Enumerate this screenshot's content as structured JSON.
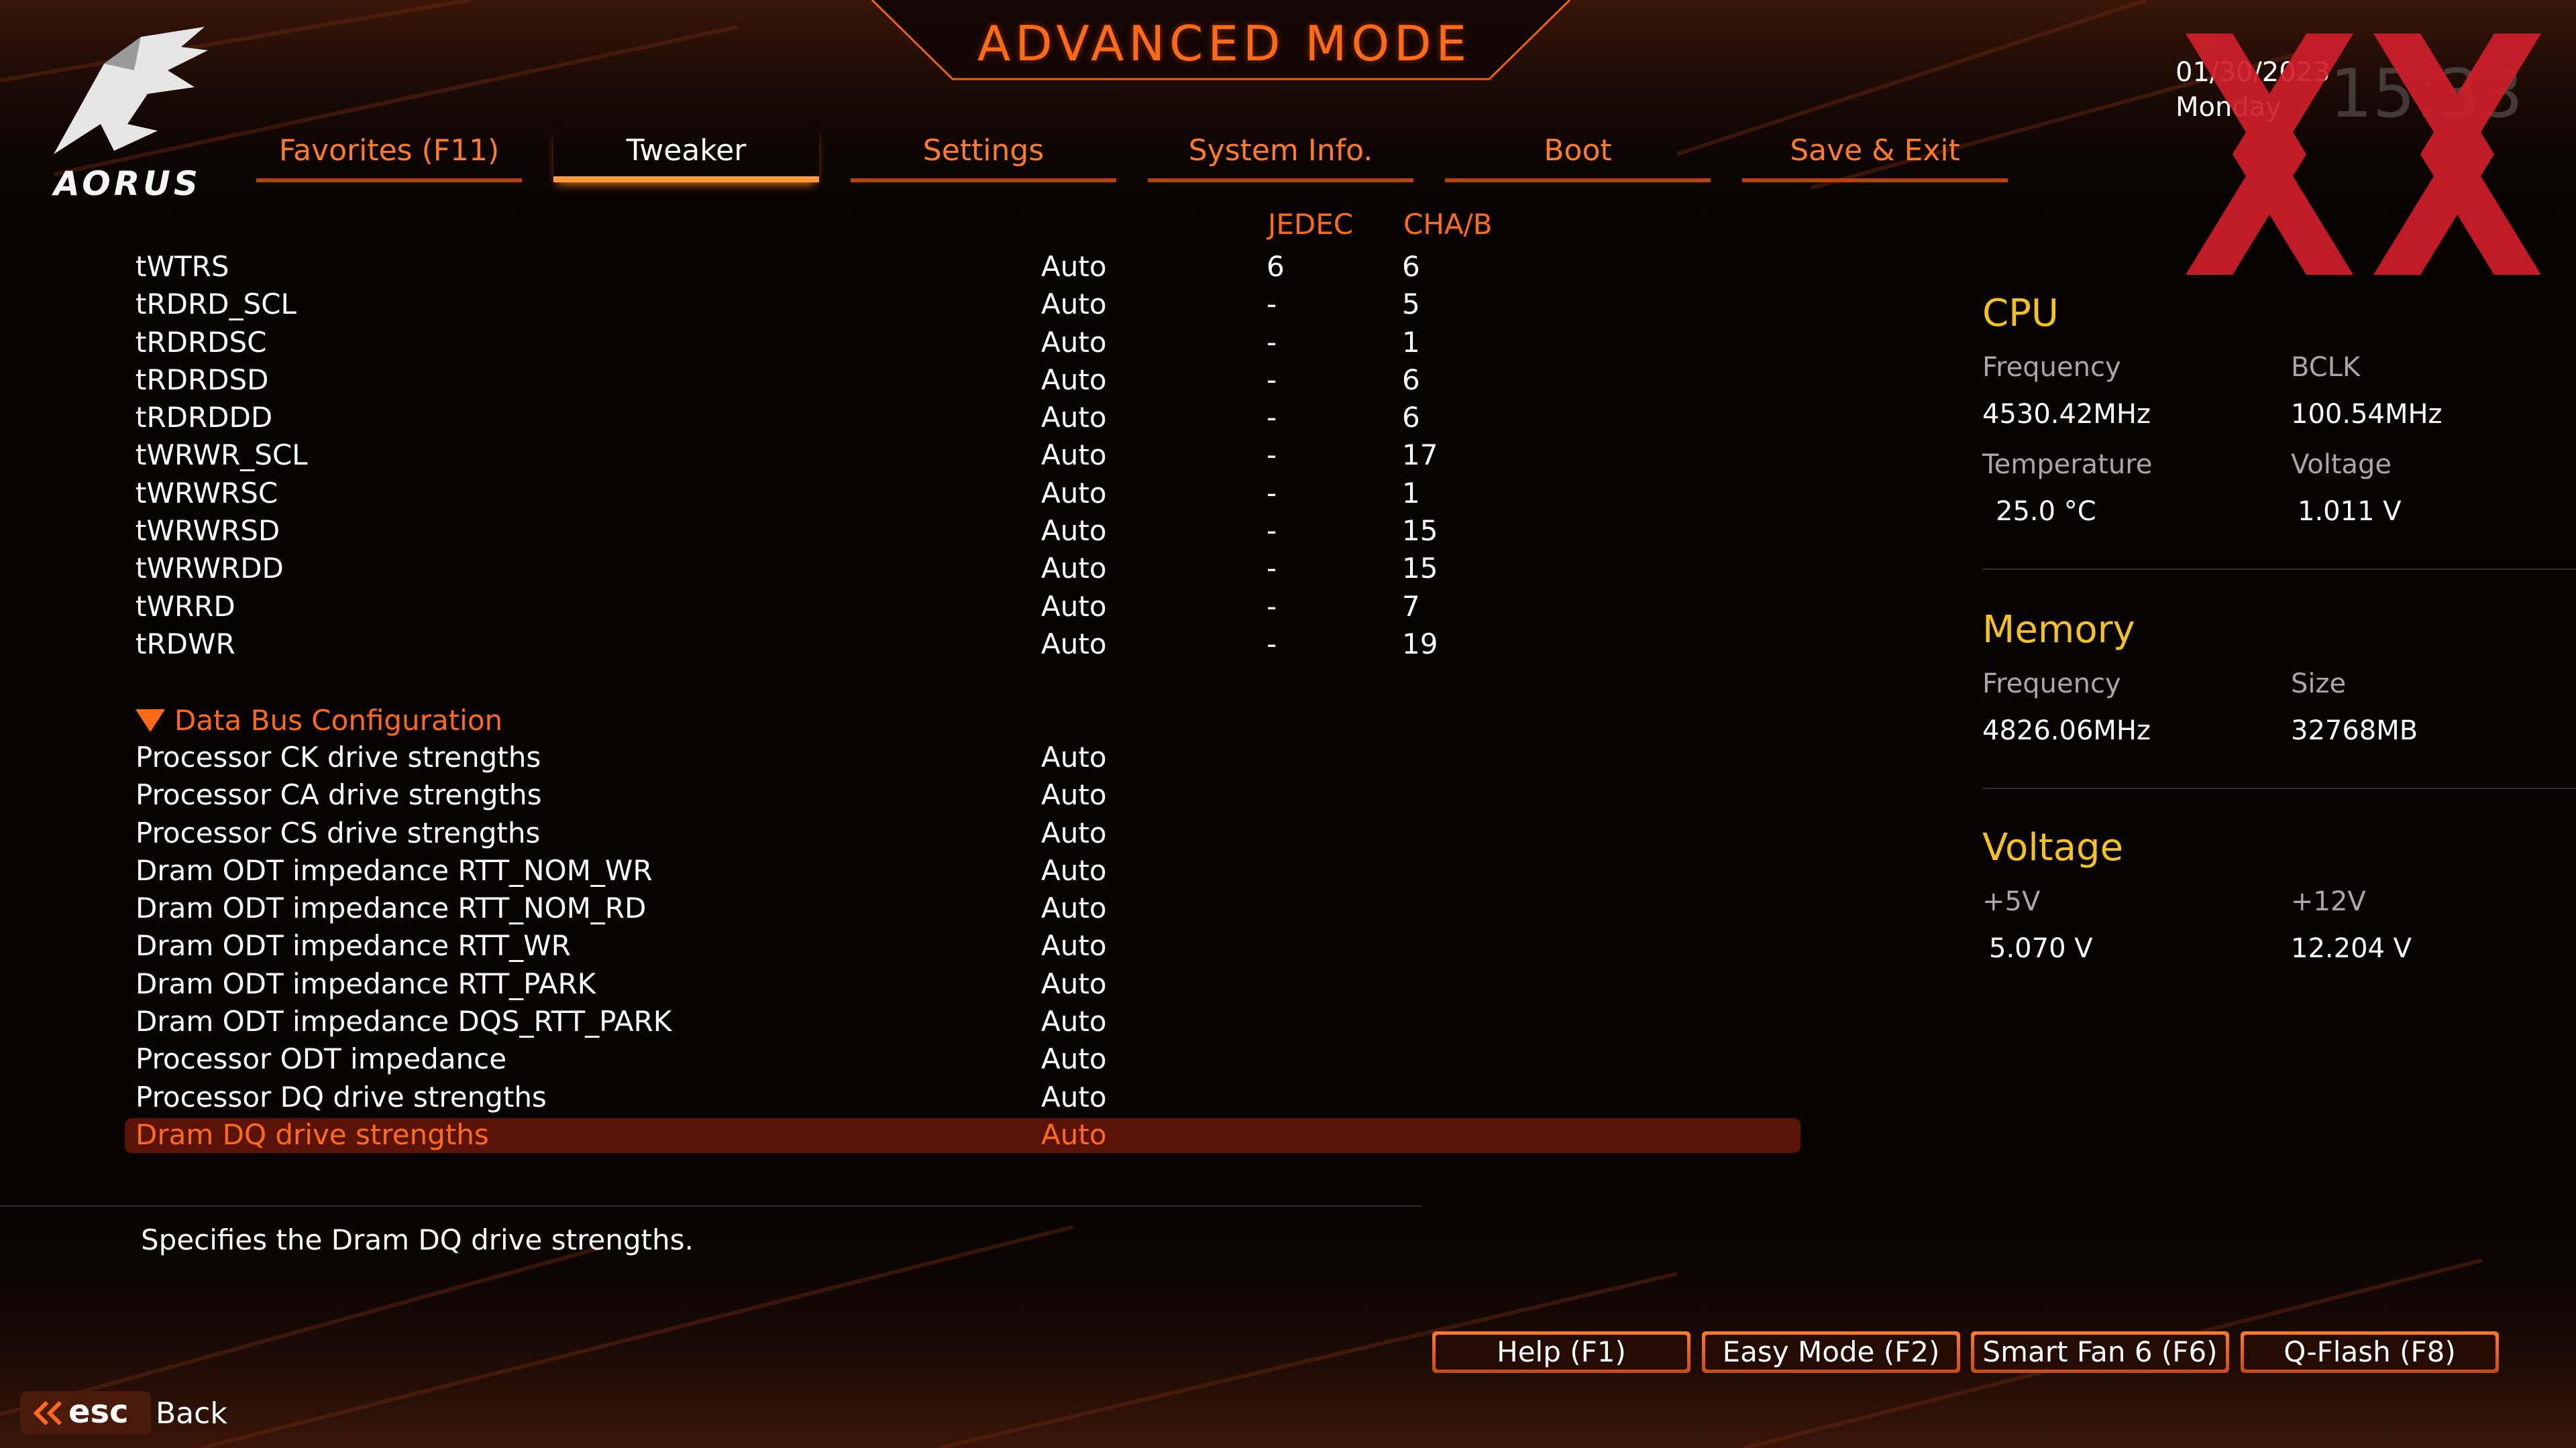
{
  "header": {
    "title": "ADVANCED MODE",
    "brand": "AORUS",
    "date": "01/30/2023",
    "day": "Monday",
    "time": "15:33"
  },
  "tabs": [
    {
      "label": "Favorites (F11)",
      "active": false
    },
    {
      "label": "Tweaker",
      "active": true
    },
    {
      "label": "Settings",
      "active": false
    },
    {
      "label": "System Info.",
      "active": false
    },
    {
      "label": "Boot",
      "active": false
    },
    {
      "label": "Save & Exit",
      "active": false
    }
  ],
  "columns": {
    "jedec": "JEDEC",
    "cha_b": "CHA/B"
  },
  "timings": [
    {
      "name": "tWTRS",
      "value": "Auto",
      "jedec": "6",
      "cha_b": "6"
    },
    {
      "name": "tRDRD_SCL",
      "value": "Auto",
      "jedec": "-",
      "cha_b": "5"
    },
    {
      "name": "tRDRDSC",
      "value": "Auto",
      "jedec": "-",
      "cha_b": "1"
    },
    {
      "name": "tRDRDSD",
      "value": "Auto",
      "jedec": "-",
      "cha_b": "6"
    },
    {
      "name": "tRDRDDD",
      "value": "Auto",
      "jedec": "-",
      "cha_b": "6"
    },
    {
      "name": "tWRWR_SCL",
      "value": "Auto",
      "jedec": "-",
      "cha_b": "17"
    },
    {
      "name": "tWRWRSC",
      "value": "Auto",
      "jedec": "-",
      "cha_b": "1"
    },
    {
      "name": "tWRWRSD",
      "value": "Auto",
      "jedec": "-",
      "cha_b": "15"
    },
    {
      "name": "tWRWRDD",
      "value": "Auto",
      "jedec": "-",
      "cha_b": "15"
    },
    {
      "name": "tWRRD",
      "value": "Auto",
      "jedec": "-",
      "cha_b": "7"
    },
    {
      "name": "tRDWR",
      "value": "Auto",
      "jedec": "-",
      "cha_b": "19"
    }
  ],
  "section": {
    "label": "Data Bus Configuration"
  },
  "bus_items": [
    {
      "name": "Processor CK drive strengths",
      "value": "Auto"
    },
    {
      "name": "Processor CA drive strengths",
      "value": "Auto"
    },
    {
      "name": "Processor CS drive strengths",
      "value": "Auto"
    },
    {
      "name": "Dram ODT impedance RTT_NOM_WR",
      "value": "Auto"
    },
    {
      "name": "Dram ODT impedance RTT_NOM_RD",
      "value": "Auto"
    },
    {
      "name": "Dram ODT impedance RTT_WR",
      "value": "Auto"
    },
    {
      "name": "Dram ODT impedance RTT_PARK",
      "value": "Auto"
    },
    {
      "name": "Dram ODT impedance DQS_RTT_PARK",
      "value": "Auto"
    },
    {
      "name": "Processor ODT impedance",
      "value": "Auto"
    },
    {
      "name": "Processor DQ drive strengths",
      "value": "Auto"
    },
    {
      "name": "Dram DQ drive strengths",
      "value": "Auto",
      "selected": true
    }
  ],
  "help_text": "Specifies the Dram DQ drive strengths.",
  "cpu": {
    "heading": "CPU",
    "freq_label": "Frequency",
    "freq_value": "4530.42MHz",
    "bclk_label": "BCLK",
    "bclk_value": "100.54MHz",
    "temp_label": "Temperature",
    "temp_value": "25.0 °C",
    "volt_label": "Voltage",
    "volt_value": "1.011 V"
  },
  "memory": {
    "heading": "Memory",
    "freq_label": "Frequency",
    "freq_value": "4826.06MHz",
    "size_label": "Size",
    "size_value": "32768MB"
  },
  "voltage": {
    "heading": "Voltage",
    "v5_label": "+5V",
    "v5_value": "5.070 V",
    "v12_label": "+12V",
    "v12_value": "12.204 V"
  },
  "footer": {
    "buttons": [
      {
        "label": "Help (F1)"
      },
      {
        "label": "Easy Mode (F2)"
      },
      {
        "label": "Smart Fan 6 (F6)"
      },
      {
        "label": "Q-Flash (F8)"
      }
    ],
    "esc_label": "esc",
    "back_label": "Back"
  },
  "colors": {
    "accent": "#ff6a14",
    "selected_row": "#5a1407",
    "panel_heading": "#f4c21e",
    "watermark": "#d11f2a"
  },
  "icons": [
    "aorus-eagle-logo",
    "collapse-triangle-icon",
    "esc-chevron-icon",
    "watermark-xx-logo"
  ]
}
